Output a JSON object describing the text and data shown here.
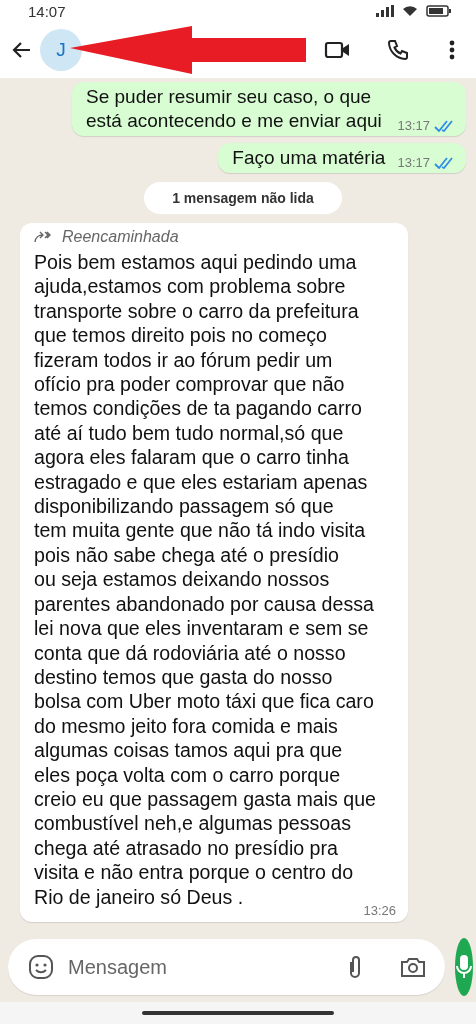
{
  "status_bar": {
    "time": "14:07"
  },
  "header": {
    "avatar_initial": "J"
  },
  "annotation": {
    "kind": "arrow"
  },
  "messages": [
    {
      "kind": "outgoing",
      "text": "Se puder resumir seu caso, o que está acontecendo e me enviar aqui",
      "time": "13:17",
      "read": true
    },
    {
      "kind": "outgoing",
      "text": "Faço uma matéria",
      "time": "13:17",
      "read": true
    },
    {
      "kind": "unread_divider",
      "text": "1 mensagem não lida"
    },
    {
      "kind": "incoming",
      "forwarded_label": "Reencaminhada",
      "text": "Pois bem estamos aqui pedindo uma\najuda,estamos com problema sobre\ntransporte sobre o carro da prefeitura\nque temos direito pois no começo\nfizeram todos ir ao fórum pedir um\nofício pra poder comprovar que não\ntemos condições de ta pagando carro\naté aí tudo bem tudo normal,só que\nagora eles falaram que o carro tinha\nestragado e que eles estariam apenas\ndisponibilizando passagem só que\ntem muita gente que não tá indo visita\npois não sabe chega até o presídio\nou seja estamos deixando nossos\nparentes abandonado por causa dessa\nlei nova que eles inventaram e sem se\nconta que dá rodoviária até o nosso\ndestino temos que gasta do nosso\nbolsa com Uber moto táxi que fica caro\ndo mesmo jeito fora comida e mais\nalgumas coisas tamos aqui pra que\neles poça volta com o carro porque\ncreio eu que passagem gasta mais que\ncombustível neh,e algumas pessoas\nchega até atrasado no presídio pra\nvisita e não entra porque o centro do\nRio de janeiro só Deus .",
      "time": "13:26"
    }
  ],
  "composer": {
    "placeholder": "Mensagem"
  }
}
